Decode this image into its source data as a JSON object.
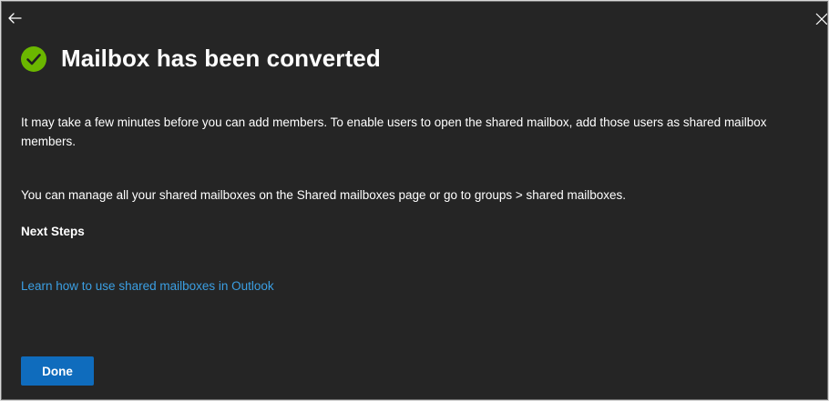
{
  "header": {
    "back_icon": "arrow-left-icon",
    "close_icon": "close-icon"
  },
  "title": {
    "icon": "check-circle-icon",
    "icon_color": "#6bb700",
    "text": "Mailbox has been converted"
  },
  "body": {
    "paragraph1": "It may take a few minutes before you can add members. To enable users to open the shared mailbox, add those users as shared mailbox members.",
    "paragraph2": "You can manage all your shared mailboxes on the Shared mailboxes page or go to groups > shared mailboxes.",
    "next_steps_heading": "Next Steps",
    "learn_link": "Learn how to use shared mailboxes in Outlook",
    "link_color": "#3b9fe3"
  },
  "footer": {
    "done_label": "Done",
    "button_color": "#0f6cbd"
  }
}
